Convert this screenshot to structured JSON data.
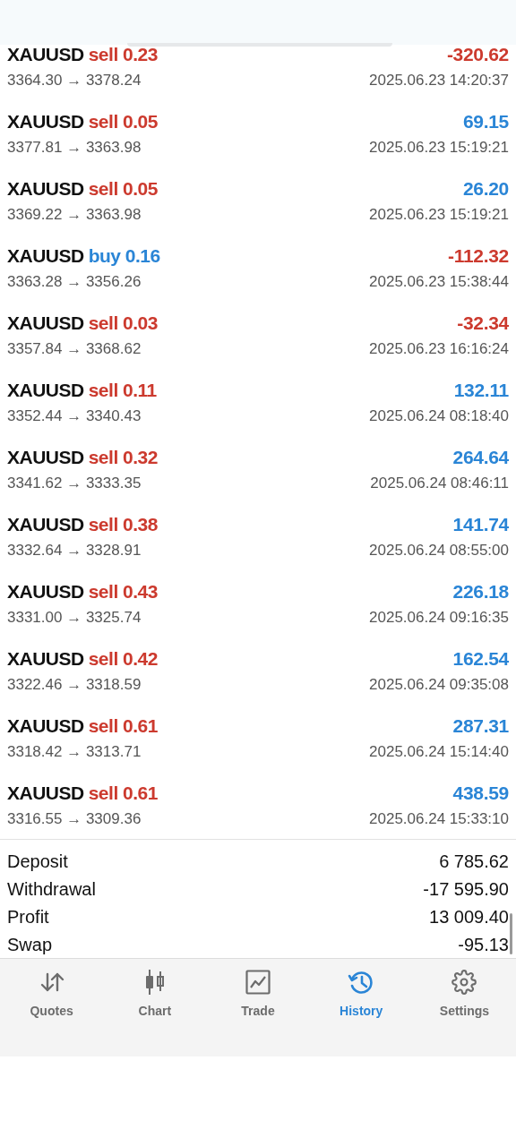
{
  "deals": [
    {
      "symbol": "XAUUSD",
      "order": {
        "text": "sell 0.23",
        "color": "#cc3a2e"
      },
      "profit": {
        "text": "-320.62",
        "color": "#cc3a2e"
      },
      "prices": "3364.30 → 3378.24",
      "time": "2025.06.23 14:20:37"
    },
    {
      "symbol": "XAUUSD",
      "order": {
        "text": "sell 0.05",
        "color": "#cc3a2e"
      },
      "profit": {
        "text": "69.15",
        "color": "#2a85d6"
      },
      "prices": "3377.81 → 3363.98",
      "time": "2025.06.23 15:19:21"
    },
    {
      "symbol": "XAUUSD",
      "order": {
        "text": "sell 0.05",
        "color": "#cc3a2e"
      },
      "profit": {
        "text": "26.20",
        "color": "#2a85d6"
      },
      "prices": "3369.22 → 3363.98",
      "time": "2025.06.23 15:19:21"
    },
    {
      "symbol": "XAUUSD",
      "order": {
        "text": "buy 0.16",
        "color": "#2a85d6"
      },
      "profit": {
        "text": "-112.32",
        "color": "#cc3a2e"
      },
      "prices": "3363.28 → 3356.26",
      "time": "2025.06.23 15:38:44"
    },
    {
      "symbol": "XAUUSD",
      "order": {
        "text": "sell 0.03",
        "color": "#cc3a2e"
      },
      "profit": {
        "text": "-32.34",
        "color": "#cc3a2e"
      },
      "prices": "3357.84 → 3368.62",
      "time": "2025.06.23 16:16:24"
    },
    {
      "symbol": "XAUUSD",
      "order": {
        "text": "sell 0.11",
        "color": "#cc3a2e"
      },
      "profit": {
        "text": "132.11",
        "color": "#2a85d6"
      },
      "prices": "3352.44 → 3340.43",
      "time": "2025.06.24 08:18:40"
    },
    {
      "symbol": "XAUUSD",
      "order": {
        "text": "sell 0.32",
        "color": "#cc3a2e"
      },
      "profit": {
        "text": "264.64",
        "color": "#2a85d6"
      },
      "prices": "3341.62 → 3333.35",
      "time": "2025.06.24 08:46:11"
    },
    {
      "symbol": "XAUUSD",
      "order": {
        "text": "sell 0.38",
        "color": "#cc3a2e"
      },
      "profit": {
        "text": "141.74",
        "color": "#2a85d6"
      },
      "prices": "3332.64 → 3328.91",
      "time": "2025.06.24 08:55:00"
    },
    {
      "symbol": "XAUUSD",
      "order": {
        "text": "sell 0.43",
        "color": "#cc3a2e"
      },
      "profit": {
        "text": "226.18",
        "color": "#2a85d6"
      },
      "prices": "3331.00 → 3325.74",
      "time": "2025.06.24 09:16:35"
    },
    {
      "symbol": "XAUUSD",
      "order": {
        "text": "sell 0.42",
        "color": "#cc3a2e"
      },
      "profit": {
        "text": "162.54",
        "color": "#2a85d6"
      },
      "prices": "3322.46 → 3318.59",
      "time": "2025.06.24 09:35:08"
    },
    {
      "symbol": "XAUUSD",
      "order": {
        "text": "sell 0.61",
        "color": "#cc3a2e"
      },
      "profit": {
        "text": "287.31",
        "color": "#2a85d6"
      },
      "prices": "3318.42 → 3313.71",
      "time": "2025.06.24 15:14:40"
    },
    {
      "symbol": "XAUUSD",
      "order": {
        "text": "sell 0.61",
        "color": "#cc3a2e"
      },
      "profit": {
        "text": "438.59",
        "color": "#2a85d6"
      },
      "prices": "3316.55 → 3309.36",
      "time": "2025.06.24 15:33:10"
    }
  ],
  "summary": [
    {
      "label": "Deposit",
      "value": "6 785.62"
    },
    {
      "label": "Withdrawal",
      "value": "-17 595.90"
    },
    {
      "label": "Profit",
      "value": "13 009.40"
    },
    {
      "label": "Swap",
      "value": "-95.13"
    }
  ],
  "tabs": [
    {
      "kind": "quotes",
      "label": "Quotes",
      "selected": false
    },
    {
      "kind": "chart",
      "label": "Chart",
      "selected": false
    },
    {
      "kind": "trade",
      "label": "Trade",
      "selected": false
    },
    {
      "kind": "history",
      "label": "History",
      "selected": true
    },
    {
      "kind": "settings",
      "label": "Settings",
      "selected": false
    }
  ]
}
